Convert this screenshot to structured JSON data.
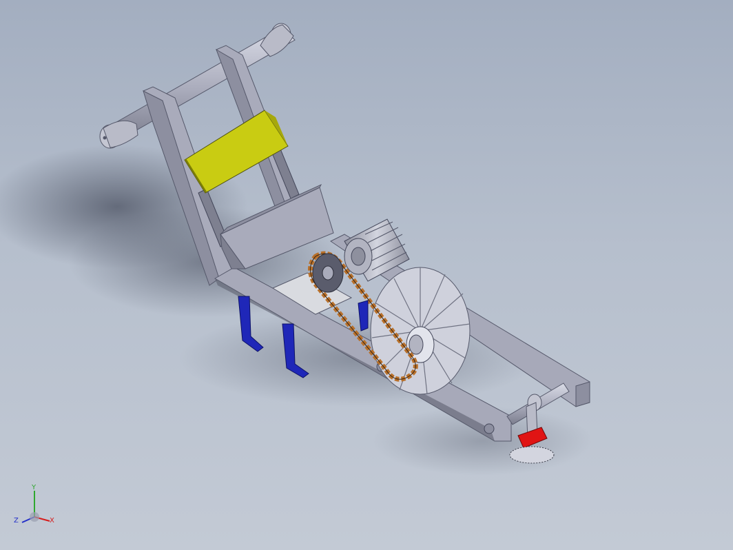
{
  "scene": {
    "background_top": "#a3aec0",
    "background_bottom": "#c3cad5",
    "colors": {
      "frame": "#a7a9b9",
      "frame_dark": "#6f7282",
      "hopper_yellow": "#c9cc12",
      "chain": "#b8702a",
      "gear": "#cfd1dc",
      "tines_blue": "#1f27b8",
      "tine_red": "#e01414",
      "plate": "#d9dbe0"
    },
    "parts": [
      "handle-bar",
      "frame",
      "seed-box",
      "hopper",
      "roller-drum",
      "sprocket",
      "chain",
      "seed-plate-wheel",
      "furrow-tines",
      "front-roller-axle",
      "ground-wheel",
      "marker-bracket"
    ]
  },
  "triad": {
    "x_label": "X",
    "y_label": "Y",
    "z_label": "Z",
    "x_color": "#d61c1c",
    "y_color": "#2fa82f",
    "z_color": "#2430c8"
  }
}
